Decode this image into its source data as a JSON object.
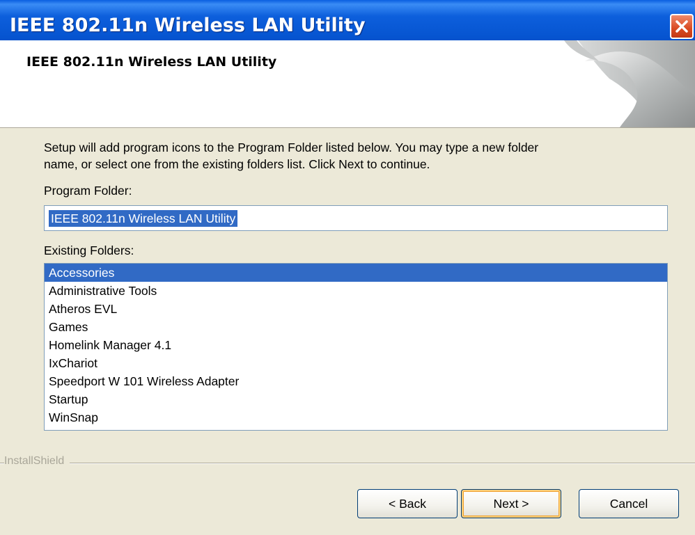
{
  "window": {
    "title": "IEEE 802.11n Wireless LAN Utility"
  },
  "header": {
    "title": "IEEE 802.11n Wireless LAN Utility"
  },
  "instructions": {
    "line1": "Setup will add program icons to the Program Folder listed below.  You may type a new folder",
    "line2": "name, or select one from the existing folders list.  Click Next to continue."
  },
  "program_folder": {
    "label": "Program Folder:",
    "value": "IEEE 802.11n Wireless LAN Utility"
  },
  "existing_folders": {
    "label": "Existing Folders:",
    "selected": "Accessories",
    "items": [
      "Accessories",
      "Administrative Tools",
      "Atheros EVL",
      "Games",
      "Homelink Manager 4.1",
      "IxChariot",
      "Speedport W 101 Wireless Adapter",
      "Startup",
      "WinSnap"
    ]
  },
  "brand": {
    "text": "InstallShield"
  },
  "buttons": {
    "back": "< Back",
    "next": "Next >",
    "cancel": "Cancel"
  },
  "icons": {
    "close": "close-icon",
    "header_graphic": "page-curl-graphic"
  },
  "colors": {
    "titlebar": "#0654d0",
    "selection": "#316ac5",
    "dialog_background": "#ece9d8",
    "close_button": "#d94a22"
  }
}
